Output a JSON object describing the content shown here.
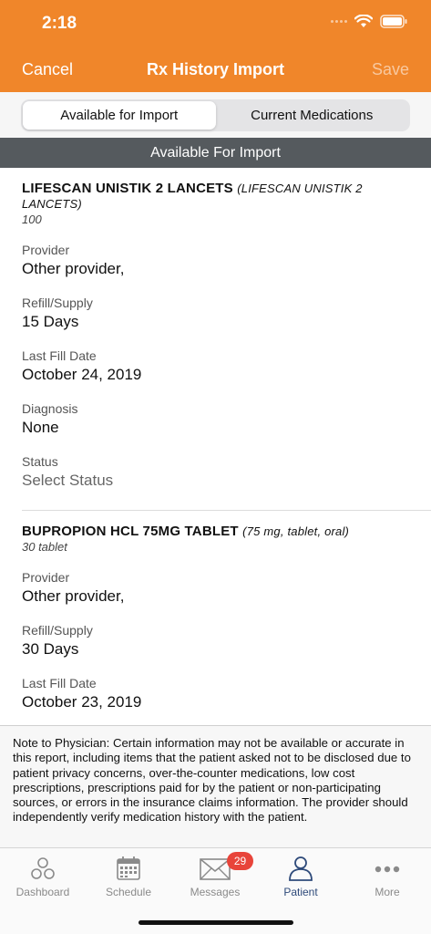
{
  "status_bar": {
    "time": "2:18"
  },
  "nav": {
    "cancel_label": "Cancel",
    "title": "Rx History Import",
    "save_label": "Save"
  },
  "segments": [
    {
      "label": "Available for Import",
      "active": true
    },
    {
      "label": "Current Medications",
      "active": false
    }
  ],
  "section_header": "Available For Import",
  "medications": [
    {
      "name": "LIFESCAN UNISTIK 2 LANCETS",
      "detail": "(LIFESCAN UNISTIK 2 LANCETS)",
      "quantity": "100",
      "fields": [
        {
          "label": "Provider",
          "value": "Other provider,"
        },
        {
          "label": "Refill/Supply",
          "value": "15 Days"
        },
        {
          "label": "Last Fill Date",
          "value": "October 24, 2019"
        },
        {
          "label": "Diagnosis",
          "value": "None"
        },
        {
          "label": "Status",
          "value": "Select Status"
        }
      ]
    },
    {
      "name": "BUPROPION HCL 75MG TABLET",
      "detail": "(75 mg, tablet, oral)",
      "quantity": "30 tablet",
      "fields": [
        {
          "label": "Provider",
          "value": "Other provider,"
        },
        {
          "label": "Refill/Supply",
          "value": "30 Days"
        },
        {
          "label": "Last Fill Date",
          "value": "October 23, 2019"
        }
      ]
    }
  ],
  "note": "Note to Physician: Certain information may not be available or accurate in this report, including items that the patient asked not to be disclosed due to patient privacy concerns, over-the-counter medications, low cost prescriptions, prescriptions paid for by the patient or non-participating sources, or errors in the insurance claims information. The provider should independently verify medication history with the patient.",
  "tabs": [
    {
      "label": "Dashboard",
      "icon": "dashboard-icon"
    },
    {
      "label": "Schedule",
      "icon": "calendar-icon"
    },
    {
      "label": "Messages",
      "icon": "envelope-icon",
      "badge": "29"
    },
    {
      "label": "Patient",
      "icon": "person-icon",
      "active": true
    },
    {
      "label": "More",
      "icon": "more-dots-icon"
    }
  ],
  "colors": {
    "accent": "#f0862a",
    "section_header": "#555a5e",
    "active_tab": "#2e4a7a",
    "badge": "#e8443a"
  }
}
